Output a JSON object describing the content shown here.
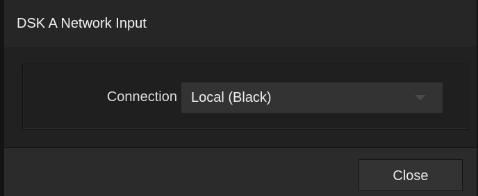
{
  "window": {
    "title": "DSK A Network Input"
  },
  "connection": {
    "label": "Connection",
    "selected_value": "Local (Black)",
    "arrow_icon": "chevron-down-icon"
  },
  "footer": {
    "close_label": "Close"
  },
  "colors": {
    "background": "#212121",
    "titlebar": "#262626",
    "control": "#333333",
    "text": "#eeeeee"
  }
}
